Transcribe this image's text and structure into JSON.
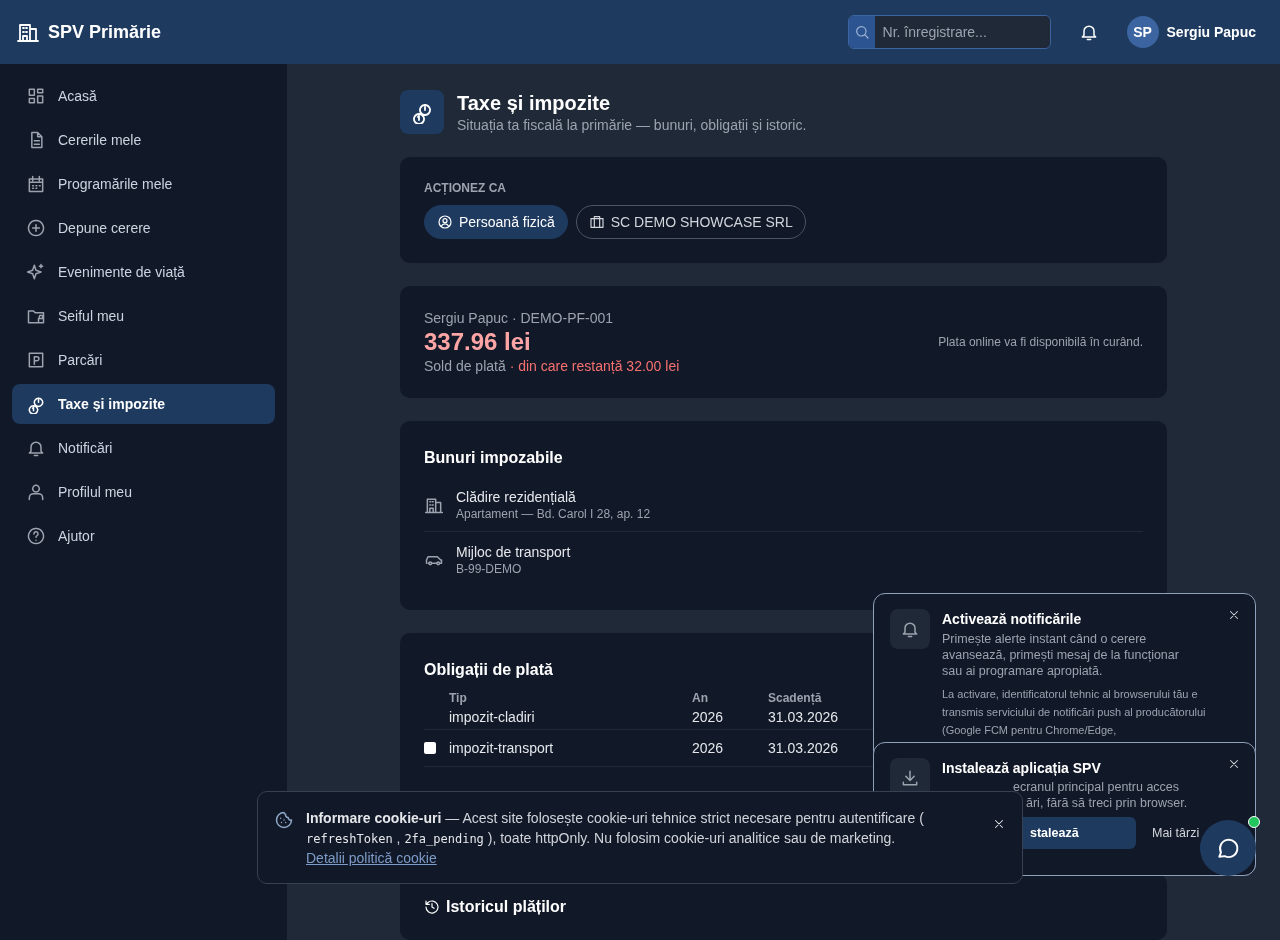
{
  "app": {
    "title": "SPV Primărie"
  },
  "header": {
    "search": {
      "placeholder": "Nr. înregistrare..."
    },
    "user": {
      "initials": "SP",
      "name": "Sergiu Papuc"
    }
  },
  "sidebar": {
    "items": [
      {
        "label": "Acasă",
        "selected": false
      },
      {
        "label": "Cererile mele",
        "selected": false
      },
      {
        "label": "Programările mele",
        "selected": false
      },
      {
        "label": "Depune cerere",
        "selected": false
      },
      {
        "label": "Evenimente de viață",
        "selected": false
      },
      {
        "label": "Seiful meu",
        "selected": false
      },
      {
        "label": "Parcări",
        "selected": false
      },
      {
        "label": "Taxe și impozite",
        "selected": true
      },
      {
        "label": "Notificări",
        "selected": false
      },
      {
        "label": "Profilul meu",
        "selected": false
      },
      {
        "label": "Ajutor",
        "selected": false
      }
    ]
  },
  "page": {
    "title": "Taxe și impozite",
    "subtitle": "Situația ta fiscală la primărie — bunuri, obligații și istoric."
  },
  "acting_as": {
    "label": "ACȚIONEZ CA",
    "options": [
      {
        "kind": "person",
        "label": "Persoană fizică",
        "selected": true
      },
      {
        "kind": "company",
        "label": "SC DEMO SHOWCASE SRL",
        "selected": false
      }
    ]
  },
  "balance": {
    "holder": "Sergiu Papuc · DEMO-PF-001",
    "amount": "337.96 lei",
    "caption": "Sold de plată",
    "overdue": "· din care restanță 32.00 lei",
    "note": "Plata online va fi disponibilă în curând."
  },
  "assets": {
    "title": "Bunuri impozabile",
    "items": [
      {
        "kind": "building",
        "name": "Clădire rezidențială",
        "detail": "Apartament — Bd. Carol I 28, ap. 12"
      },
      {
        "kind": "vehicle",
        "name": "Mijloc de transport",
        "detail": "B-99-DEMO"
      }
    ]
  },
  "obligations": {
    "title": "Obligații de plată",
    "columns": [
      "Tip",
      "An",
      "Scadență"
    ],
    "rows": [
      {
        "kind": "plain",
        "cells": [
          "impozit-cladiri",
          "2026",
          "31.03.2026"
        ]
      },
      {
        "kind": "checkbox",
        "checked": false,
        "cells": [
          "impozit-transport",
          "2026",
          "31.03.2026"
        ]
      }
    ]
  },
  "history": {
    "title": "Istoricul plăților"
  },
  "notification_prompt": {
    "title": "Activează notificările",
    "text": "Primește alerte instant când o cerere avansează, primești mesaj de la funcționar sau ai programare apropiată.",
    "details": "La activare, identificatorul tehnic al browserului tău e transmis serviciului de notificări push al producătorului (Google FCM pentru Chrome/Edge,"
  },
  "install_prompt": {
    "title": "Instalează aplicația SPV",
    "text_lines": [
      "ecranul principal pentru acces",
      "ări, fără să treci prin browser."
    ],
    "install_button": "stalează",
    "later_button": "Mai târzi"
  },
  "cookie_banner": {
    "title": "Informare cookie-uri",
    "intro": "— Acest site folosește cookie-uri tehnice strict necesare pentru autentificare (",
    "codes": [
      "refreshToken",
      "2fa_pending"
    ],
    "separator": ",",
    "outro": "), toate httpOnly. Nu folosim cookie-uri analitice sau de marketing.",
    "link": "Detalii politică cookie"
  },
  "chat": {
    "online": true
  }
}
